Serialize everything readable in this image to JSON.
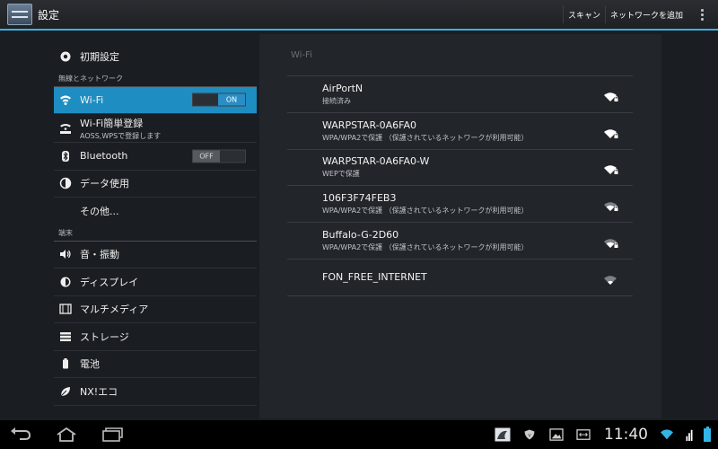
{
  "action_bar": {
    "title": "設定",
    "scan_label": "スキャン",
    "add_network_label": "ネットワークを追加"
  },
  "sidebar": {
    "top_item": {
      "label": "初期設定",
      "icon": "gear-icon"
    },
    "section_wireless": "無線とネットワーク",
    "wifi": {
      "label": "Wi-Fi",
      "toggle": "ON",
      "icon": "wifi-icon"
    },
    "wifi_easy": {
      "label": "Wi-Fi簡単登録",
      "sub": "AOSS,WPSで登録します",
      "icon": "easy-icon"
    },
    "bluetooth": {
      "label": "Bluetooth",
      "toggle": "OFF",
      "icon": "bluetooth-icon"
    },
    "data_usage": {
      "label": "データ使用",
      "icon": "pie-chart-icon"
    },
    "more": {
      "label": "その他..."
    },
    "section_device": "端末",
    "device_items": [
      {
        "label": "音・振動",
        "icon": "speaker-icon"
      },
      {
        "label": "ディスプレイ",
        "icon": "brightness-icon"
      },
      {
        "label": "マルチメディア",
        "icon": "film-icon"
      },
      {
        "label": "ストレージ",
        "icon": "storage-icon"
      },
      {
        "label": "電池",
        "icon": "battery-icon"
      },
      {
        "label": "NX!エコ",
        "icon": "leaf-icon"
      }
    ]
  },
  "wifi_panel": {
    "header": "Wi-Fi",
    "networks": [
      {
        "name": "AirPortN",
        "status": "接続済み",
        "signal": 4,
        "secured": true
      },
      {
        "name": "WARPSTAR-0A6FA0",
        "status": "WPA/WPA2で保護 （保護されているネットワークが利用可能）",
        "signal": 4,
        "secured": true
      },
      {
        "name": "WARPSTAR-0A6FA0-W",
        "status": "WEPで保護",
        "signal": 4,
        "secured": true
      },
      {
        "name": "106F3F74FEB3",
        "status": "WPA/WPA2で保護 （保護されているネットワークが利用可能）",
        "signal": 3,
        "secured": true
      },
      {
        "name": "Buffalo-G-2D60",
        "status": "WPA/WPA2で保護 （保護されているネットワークが利用可能）",
        "signal": 3,
        "secured": true
      },
      {
        "name": "FON_FREE_INTERNET",
        "status": "",
        "signal": 2,
        "secured": false
      }
    ]
  },
  "nav_bar": {
    "time": "11:40"
  },
  "colors": {
    "accent": "#33b5e5",
    "active_row": "#1e8ec2"
  }
}
